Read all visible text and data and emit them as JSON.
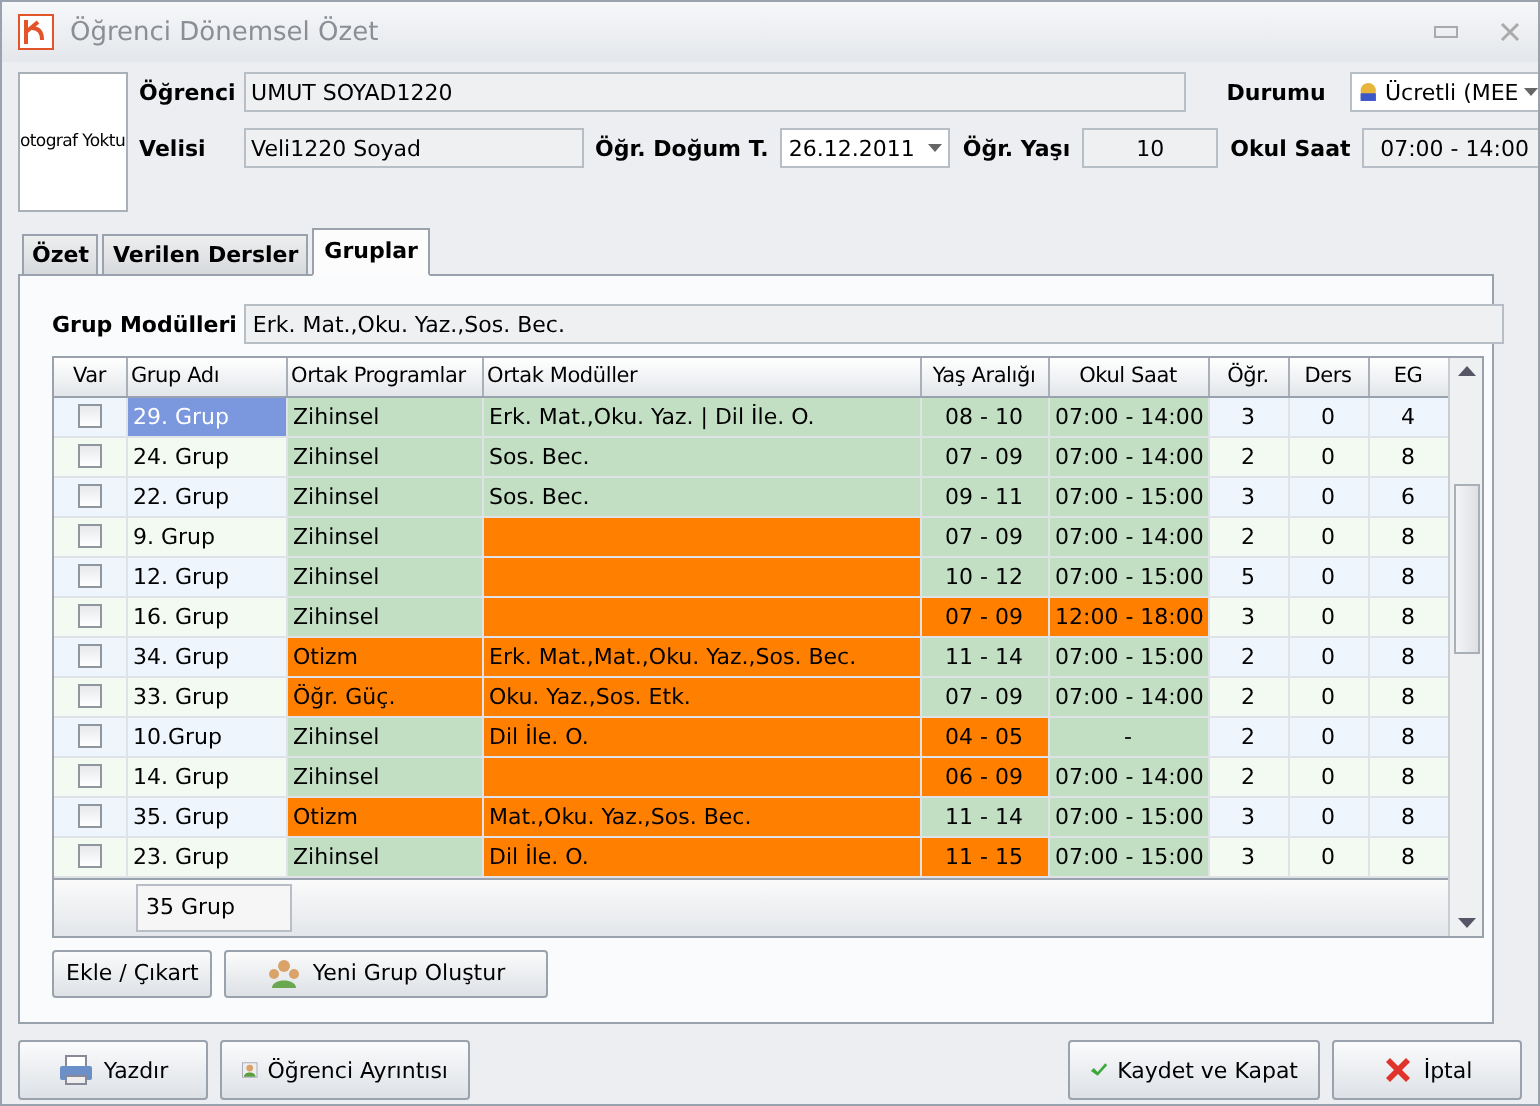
{
  "window": {
    "title": "Öğrenci Dönemsel Özet"
  },
  "photo": {
    "text": "otograf Yoktu"
  },
  "student": {
    "label": "Öğrenci",
    "value": "UMUT SOYAD1220"
  },
  "status": {
    "label": "Durumu",
    "value": "Ücretli (MEE"
  },
  "parent": {
    "label": "Velisi",
    "value": "Veli1220 Soyad"
  },
  "birth": {
    "label": "Öğr. Doğum T.",
    "value": "26.12.2011"
  },
  "age": {
    "label": "Öğr. Yaşı",
    "value": "10"
  },
  "school_hours": {
    "label": "Okul Saat",
    "value": "07:00 - 14:00"
  },
  "tabs": [
    {
      "label": "Özet",
      "selected": false
    },
    {
      "label": "Verilen Dersler",
      "selected": false
    },
    {
      "label": "Gruplar",
      "selected": true
    }
  ],
  "group_modules": {
    "label": "Grup Modülleri",
    "value": "Erk. Mat.,Oku. Yaz.,Sos. Bec."
  },
  "table": {
    "columns": [
      "Var",
      "Grup Adı",
      "Ortak Programlar",
      "Ortak Modüller",
      "Yaş Aralığı",
      "Okul Saat",
      "Öğr.",
      "Ders",
      "EG"
    ],
    "rows": [
      {
        "checked": false,
        "selected": true,
        "name": "29. Grup",
        "program": {
          "text": "Zihinsel",
          "ok": true
        },
        "modules": {
          "text": "Erk. Mat.,Oku. Yaz. | Dil İle. O.",
          "ok": true
        },
        "ages": {
          "text": "08 - 10",
          "ok": true
        },
        "hours": {
          "text": "07:00 - 14:00",
          "ok": true
        },
        "students": "3",
        "lessons": "0",
        "eg": "4"
      },
      {
        "checked": false,
        "selected": false,
        "name": "24. Grup",
        "program": {
          "text": "Zihinsel",
          "ok": true
        },
        "modules": {
          "text": "Sos. Bec.",
          "ok": true
        },
        "ages": {
          "text": "07 - 09",
          "ok": true
        },
        "hours": {
          "text": "07:00 - 14:00",
          "ok": true
        },
        "students": "2",
        "lessons": "0",
        "eg": "8"
      },
      {
        "checked": false,
        "selected": false,
        "name": "22. Grup",
        "program": {
          "text": "Zihinsel",
          "ok": true
        },
        "modules": {
          "text": "Sos. Bec.",
          "ok": true
        },
        "ages": {
          "text": "09 - 11",
          "ok": true
        },
        "hours": {
          "text": "07:00 - 15:00",
          "ok": true
        },
        "students": "3",
        "lessons": "0",
        "eg": "6"
      },
      {
        "checked": false,
        "selected": false,
        "name": "9. Grup",
        "program": {
          "text": "Zihinsel",
          "ok": true
        },
        "modules": {
          "ok": false
        },
        "ages": {
          "text": "07 - 09",
          "ok": true
        },
        "hours": {
          "text": "07:00 - 14:00",
          "ok": true
        },
        "students": "2",
        "lessons": "0",
        "eg": "8"
      },
      {
        "checked": false,
        "selected": false,
        "name": "12. Grup",
        "program": {
          "text": "Zihinsel",
          "ok": true
        },
        "modules": {
          "ok": false
        },
        "ages": {
          "text": "10 - 12",
          "ok": true
        },
        "hours": {
          "text": "07:00 - 15:00",
          "ok": true
        },
        "students": "5",
        "lessons": "0",
        "eg": "8"
      },
      {
        "checked": false,
        "selected": false,
        "name": "16. Grup",
        "program": {
          "text": "Zihinsel",
          "ok": true
        },
        "modules": {
          "ok": false
        },
        "ages": {
          "text": "07 - 09",
          "ok": false
        },
        "hours": {
          "text": "12:00 - 18:00",
          "ok": false
        },
        "students": "3",
        "lessons": "0",
        "eg": "8"
      },
      {
        "checked": false,
        "selected": false,
        "name": "34. Grup",
        "program": {
          "text": "Otizm",
          "ok": false
        },
        "modules": {
          "text": "Erk. Mat.,Mat.,Oku. Yaz.,Sos. Bec.",
          "ok": false
        },
        "ages": {
          "text": "11 - 14",
          "ok": true
        },
        "hours": {
          "text": "07:00 - 15:00",
          "ok": true
        },
        "students": "2",
        "lessons": "0",
        "eg": "8"
      },
      {
        "checked": false,
        "selected": false,
        "name": "33. Grup",
        "program": {
          "text": "Öğr. Güç.",
          "ok": false
        },
        "modules": {
          "text": "Oku. Yaz.,Sos. Etk.",
          "ok": false
        },
        "ages": {
          "text": "07 - 09",
          "ok": true
        },
        "hours": {
          "text": "07:00 - 14:00",
          "ok": true
        },
        "students": "2",
        "lessons": "0",
        "eg": "8"
      },
      {
        "checked": false,
        "selected": false,
        "name": "10.Grup",
        "program": {
          "text": "Zihinsel",
          "ok": true
        },
        "modules": {
          "text": "Dil İle. O.",
          "ok": false
        },
        "ages": {
          "text": "04 - 05",
          "ok": false
        },
        "hours": {
          "text": "-",
          "ok": true
        },
        "students": "2",
        "lessons": "0",
        "eg": "8"
      },
      {
        "checked": false,
        "selected": false,
        "name": "14. Grup",
        "program": {
          "text": "Zihinsel",
          "ok": true
        },
        "modules": {
          "ok": false
        },
        "ages": {
          "text": "06 - 09",
          "ok": false
        },
        "hours": {
          "text": "07:00 - 14:00",
          "ok": true
        },
        "students": "2",
        "lessons": "0",
        "eg": "8"
      },
      {
        "checked": false,
        "selected": false,
        "name": "35. Grup",
        "program": {
          "text": "Otizm",
          "ok": false
        },
        "modules": {
          "text": "Mat.,Oku. Yaz.,Sos. Bec.",
          "ok": false
        },
        "ages": {
          "text": "11 - 14",
          "ok": true
        },
        "hours": {
          "text": "07:00 - 15:00",
          "ok": true
        },
        "students": "3",
        "lessons": "0",
        "eg": "8"
      },
      {
        "checked": false,
        "selected": false,
        "name": "23. Grup",
        "program": {
          "text": "Zihinsel",
          "ok": true
        },
        "modules": {
          "text": "Dil İle. O.",
          "ok": false
        },
        "ages": {
          "text": "11 - 15",
          "ok": false
        },
        "hours": {
          "text": "07:00 - 15:00",
          "ok": true
        },
        "students": "3",
        "lessons": "0",
        "eg": "8"
      }
    ],
    "footer": "35 Grup"
  },
  "group_buttons": [
    "Ekle / Çıkart",
    "Yeni Grup Oluştur"
  ],
  "bottom_left_buttons": [
    "Yazdır",
    "Öğrenci Ayrıntısı"
  ],
  "bottom_right_buttons": [
    "Kaydet ve Kapat",
    "İptal"
  ]
}
